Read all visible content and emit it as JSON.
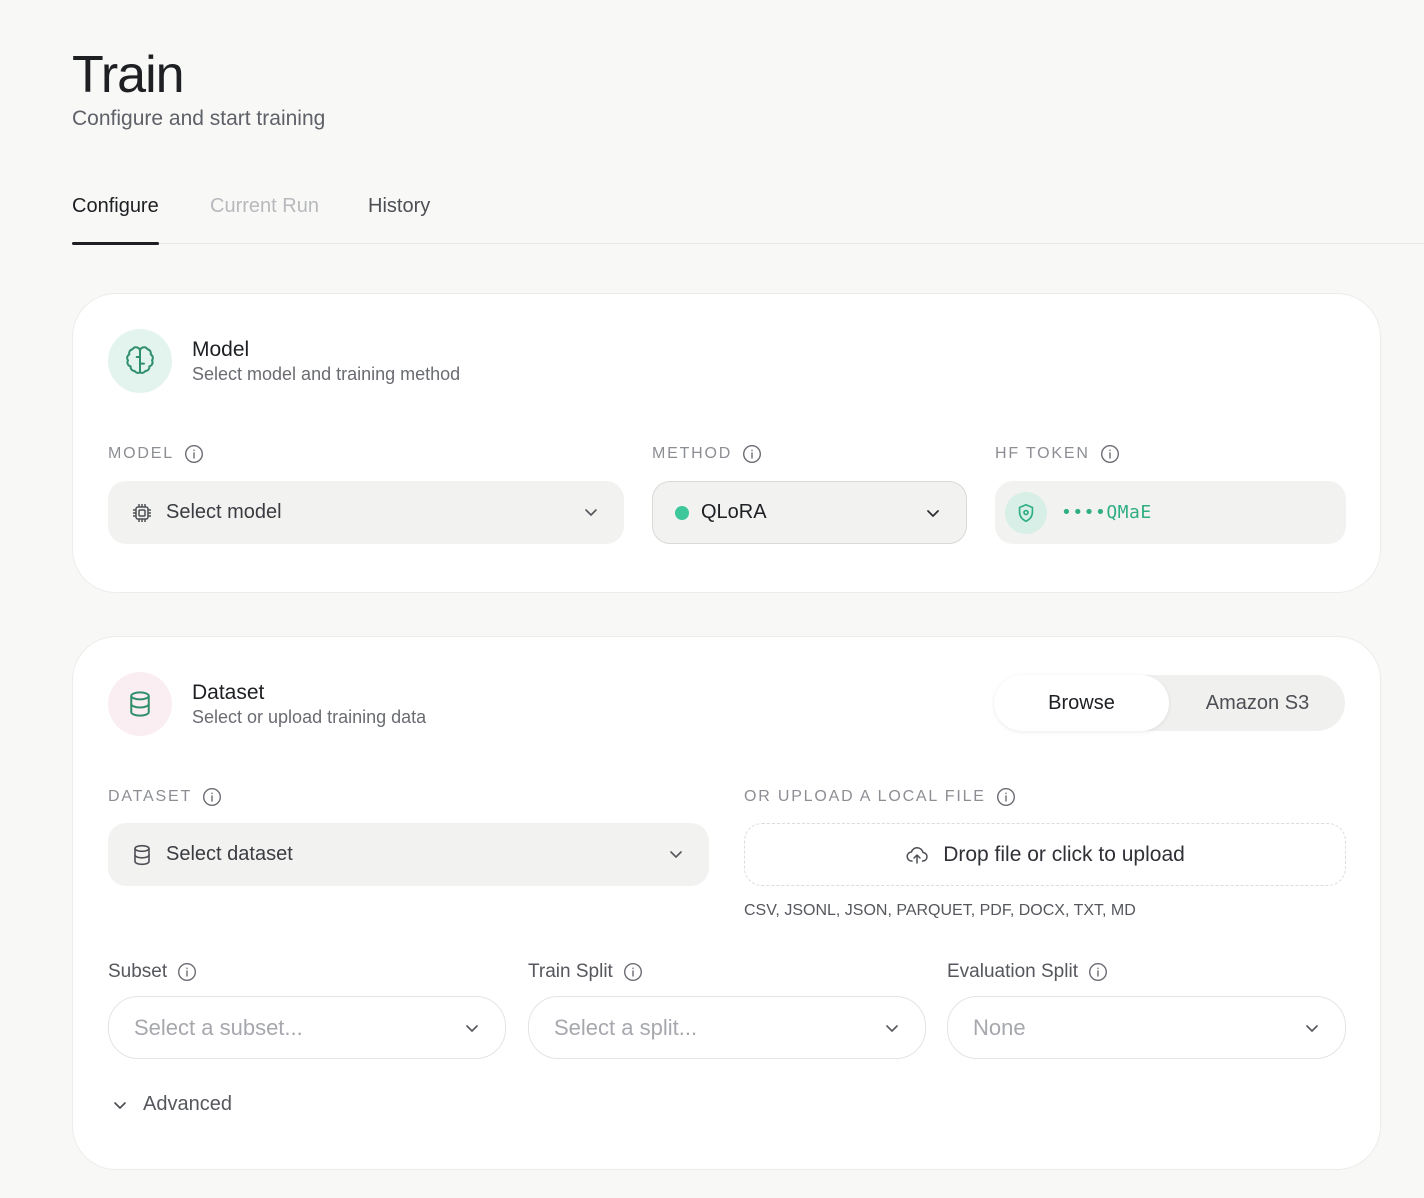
{
  "header": {
    "title": "Train",
    "subtitle": "Configure and start training"
  },
  "tabs": [
    {
      "label": "Configure",
      "state": "active"
    },
    {
      "label": "Current Run",
      "state": "disabled"
    },
    {
      "label": "History",
      "state": "inactive"
    }
  ],
  "model_card": {
    "icon": "brain-icon",
    "title": "Model",
    "subtitle": "Select model and training method",
    "model_field": {
      "label": "MODEL",
      "placeholder": "Select model",
      "icon": "chip-icon"
    },
    "method_field": {
      "label": "METHOD",
      "value": "QLoRA",
      "status_color": "#3ec79a"
    },
    "token_field": {
      "label": "HF TOKEN",
      "value": "••••QMaE",
      "icon": "shield-icon"
    }
  },
  "dataset_card": {
    "icon": "database-icon",
    "title": "Dataset",
    "subtitle": "Select or upload training data",
    "source_toggle": {
      "options": [
        "Browse",
        "Amazon S3"
      ],
      "selected": "Browse"
    },
    "dataset_field": {
      "label": "DATASET",
      "placeholder": "Select dataset"
    },
    "upload": {
      "label": "OR UPLOAD A LOCAL FILE",
      "text": "Drop file or click to upload",
      "formats": "CSV, JSONL, JSON, PARQUET, PDF, DOCX, TXT, MD"
    },
    "subset": {
      "label": "Subset",
      "placeholder": "Select a subset..."
    },
    "train_split": {
      "label": "Train Split",
      "placeholder": "Select a split..."
    },
    "eval_split": {
      "label": "Evaluation Split",
      "value": "None"
    },
    "advanced_label": "Advanced"
  },
  "colors": {
    "accent": "#3ec79a",
    "text": "#1d1f23",
    "muted": "#8c8e93"
  }
}
